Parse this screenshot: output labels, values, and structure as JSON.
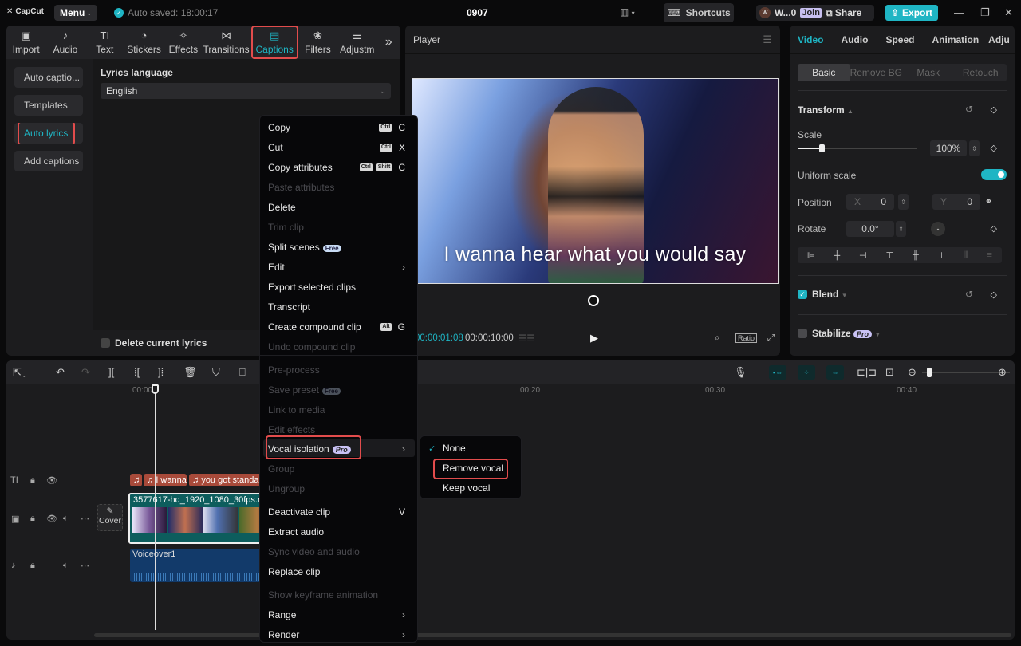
{
  "titlebar": {
    "app_name": "CapCut",
    "menu_label": "Menu",
    "autosave_text": "Auto saved: 18:00:17",
    "project_title": "0907",
    "shortcuts_label": "Shortcuts",
    "user_initial": "W",
    "user_name": "W...0",
    "join_label": "Join",
    "share_label": "Share",
    "export_label": "Export"
  },
  "toolbar_tabs": [
    {
      "label": "Import",
      "icon": "▣"
    },
    {
      "label": "Audio",
      "icon": "♪"
    },
    {
      "label": "Text",
      "icon": "TI"
    },
    {
      "label": "Stickers",
      "icon": "◔"
    },
    {
      "label": "Effects",
      "icon": "✧"
    },
    {
      "label": "Transitions",
      "icon": "⋈"
    },
    {
      "label": "Captions",
      "icon": "▤"
    },
    {
      "label": "Filters",
      "icon": "❀"
    },
    {
      "label": "Adjustm",
      "icon": "⚌"
    }
  ],
  "active_tab": "Captions",
  "captions_nav": [
    {
      "label": "Auto captio..."
    },
    {
      "label": "Templates"
    },
    {
      "label": "Auto lyrics"
    },
    {
      "label": "Add captions"
    }
  ],
  "lyrics": {
    "language_label": "Lyrics language",
    "language_value": "English",
    "delete_label": "Delete current lyrics"
  },
  "player": {
    "title": "Player",
    "caption": "I wanna hear what you would say",
    "current_time": "00:00:01:08",
    "total_time": "00:00:10:00",
    "ratio_label": "Ratio"
  },
  "props": {
    "tabs": [
      "Video",
      "Audio",
      "Speed",
      "Animation",
      "Adju"
    ],
    "subtabs": [
      "Basic",
      "Remove BG",
      "Mask",
      "Retouch"
    ],
    "transform_label": "Transform",
    "scale_label": "Scale",
    "scale_value": "100%",
    "scale_fraction": 0.2,
    "uniform_scale_label": "Uniform scale",
    "uniform_scale_on": true,
    "position_label": "Position",
    "pos_x_label": "X",
    "pos_x": "0",
    "pos_y_label": "Y",
    "pos_y": "0",
    "rotate_label": "Rotate",
    "rotate_value": "0.0°",
    "blend_label": "Blend",
    "blend_checked": true,
    "stabilize_label": "Stabilize",
    "pro_badge": "Pro"
  },
  "timeline": {
    "ruler_labels": [
      "00:00",
      "00:20",
      "00:30",
      "00:40"
    ],
    "caption_chips": [
      "",
      "I wanna",
      "you got standa"
    ],
    "video_clip_name": "3577617-hd_1920_1080_30fps.mp4",
    "cover_label": "Cover",
    "audio_clip_name": "Voiceover1"
  },
  "context_menu": {
    "items": [
      {
        "label": "Copy",
        "keys": [
          "Ctrl"
        ],
        "key": "C",
        "disabled": false
      },
      {
        "label": "Cut",
        "keys": [
          "Ctrl"
        ],
        "key": "X",
        "disabled": false
      },
      {
        "label": "Copy attributes",
        "keys": [
          "Ctrl",
          "Shift"
        ],
        "key": "C",
        "disabled": false
      },
      {
        "label": "Paste attributes",
        "disabled": true
      },
      {
        "label": "Delete",
        "disabled": false
      },
      {
        "label": "Trim clip",
        "disabled": true
      },
      {
        "label": "Split scenes",
        "badge": "Free",
        "disabled": false
      },
      {
        "label": "Edit",
        "submenu": true,
        "disabled": false
      },
      {
        "label": "Export selected clips",
        "disabled": false
      },
      {
        "label": "Transcript",
        "disabled": false
      },
      {
        "label": "Create compound clip",
        "keys": [
          "Alt"
        ],
        "key": "G",
        "disabled": false
      },
      {
        "label": "Undo compound clip",
        "disabled": true
      },
      {
        "label": "Pre-process",
        "disabled": true
      },
      {
        "label": "Save preset",
        "badge": "Free",
        "disabled": true
      },
      {
        "label": "Link to media",
        "disabled": true
      },
      {
        "label": "Edit effects",
        "disabled": true
      },
      {
        "label": "Vocal isolation",
        "badge": "Pro",
        "submenu": true,
        "disabled": false
      },
      {
        "label": "Group",
        "disabled": true
      },
      {
        "label": "Ungroup",
        "disabled": true
      },
      {
        "label": "Deactivate clip",
        "key": "V",
        "disabled": false
      },
      {
        "label": "Extract audio",
        "disabled": false
      },
      {
        "label": "Sync video and audio",
        "disabled": true
      },
      {
        "label": "Replace clip",
        "disabled": false
      },
      {
        "label": "Show keyframe animation",
        "disabled": true
      },
      {
        "label": "Range",
        "submenu": true,
        "disabled": false
      },
      {
        "label": "Render",
        "submenu": true,
        "disabled": false
      }
    ]
  },
  "vocal_submenu": {
    "items": [
      {
        "label": "None",
        "checked": true
      },
      {
        "label": "Remove vocal",
        "checked": false
      },
      {
        "label": "Keep vocal",
        "checked": false
      }
    ]
  },
  "colors": {
    "accent": "#1fb5c4",
    "highlight": "#e24c4c",
    "caption_clip": "#a84a3a",
    "video_clip": "#0d5d5d",
    "audio_clip": "#123a6a"
  }
}
